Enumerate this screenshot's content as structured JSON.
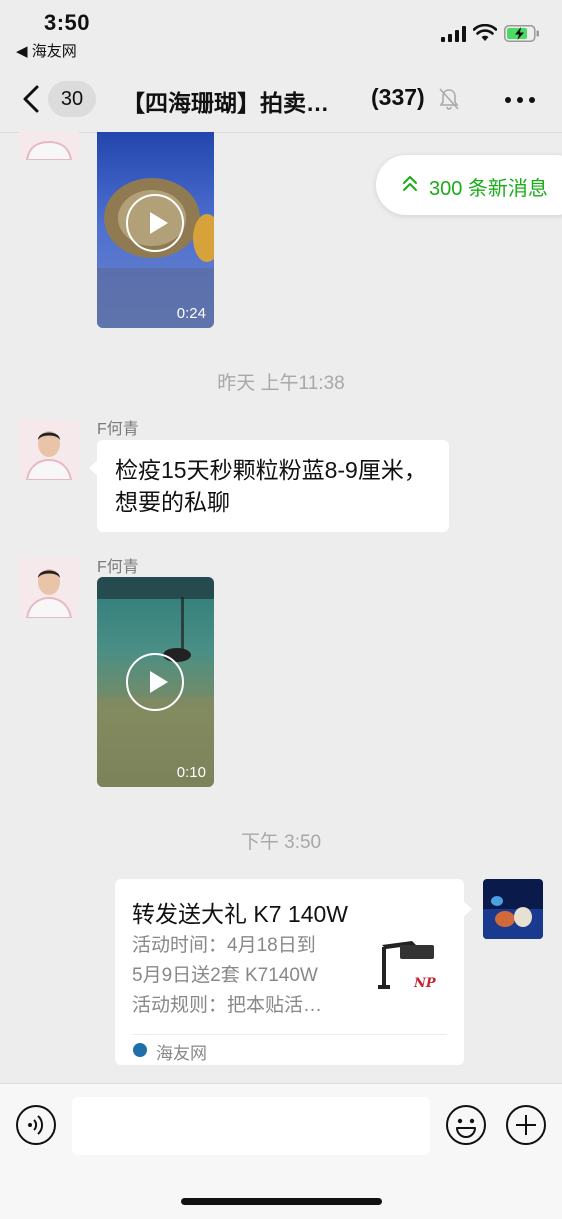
{
  "status_bar": {
    "time": "3:50",
    "back_app": "◀ 海友网"
  },
  "nav": {
    "unread_count": "30",
    "title": "【四海珊瑚】拍卖…",
    "member_count": "(337)"
  },
  "new_messages_pill": "300 条新消息",
  "messages": {
    "video1_duration": "0:24",
    "timestamp1": "昨天 上午11:38",
    "msg1_sender": "F何青",
    "msg1_text": "检疫15天秒颗粒粉蓝8-9厘米，想要的私聊",
    "msg2_sender": "F何青",
    "video2_duration": "0:10",
    "timestamp2": "下午 3:50"
  },
  "link_card": {
    "title": "转发送大礼 K7 140W",
    "desc_line1": "活动时间：4月18日到",
    "desc_line2": "5月9日送2套 K7140W",
    "desc_line3": "活动规则：把本贴活…",
    "source": "海友网",
    "thumb_logo_text": "NP"
  },
  "input_bar": {
    "placeholder": ""
  },
  "colors": {
    "background": "#ededed",
    "accent_green": "#1aad19",
    "bubble": "#ffffff",
    "muted_text": "#a8a8a8"
  }
}
